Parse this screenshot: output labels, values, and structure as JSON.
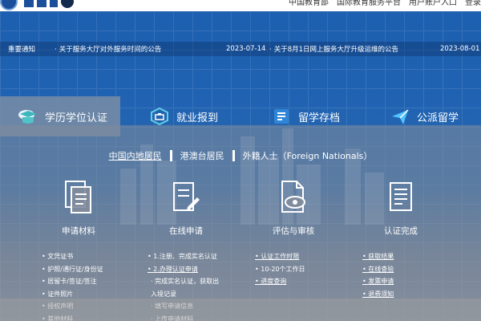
{
  "header": {
    "nav": [
      "中国教育部",
      "国际教育服务平台",
      "用户账户入口",
      "登录"
    ]
  },
  "notice": {
    "tag": "重要通知",
    "items": [
      {
        "text": "关于服务大厅对外服务时间的公告",
        "date": "2023-07-14"
      },
      {
        "text": "关于8月1日网上服务大厅升级运维的公告",
        "date": "2023-08-01"
      }
    ]
  },
  "tabs": [
    {
      "label": "学历学位认证",
      "icon": "graduation-cap-icon"
    },
    {
      "label": "就业报到",
      "icon": "briefcase-icon"
    },
    {
      "label": "留学存档",
      "icon": "archive-icon"
    },
    {
      "label": "公派留学",
      "icon": "airplane-icon"
    }
  ],
  "citizenship": {
    "options": [
      "中国内地居民",
      "港澳台居民",
      "外籍人士（Foreign Nationals）"
    ]
  },
  "steps": [
    {
      "label": "申请材料",
      "icon": "documents-icon"
    },
    {
      "label": "在线申请",
      "icon": "edit-form-icon"
    },
    {
      "label": "评估与审核",
      "icon": "review-icon"
    },
    {
      "label": "认证完成",
      "icon": "certificate-icon"
    }
  ],
  "lists": {
    "materials": [
      "• 文凭证书",
      "• 护照/通行证/身份证",
      "• 居留卡/签证/签注",
      "• 证件照片",
      "• 授权声明",
      "• 其他材料"
    ],
    "apply": [
      "• 1.注册、完成实名认证",
      "• 2.办理认证申请",
      "· 完成实名认证，获取出",
      "入境记录",
      "· 填写申请信息",
      "· 上传申请材料"
    ],
    "review": [
      "• 认证工作时限",
      "• 10-20个工作日",
      "• 进度查询"
    ],
    "complete": [
      "• 获取结果",
      "• 在线查验",
      "• 发票申请",
      "• 退费须知"
    ]
  }
}
